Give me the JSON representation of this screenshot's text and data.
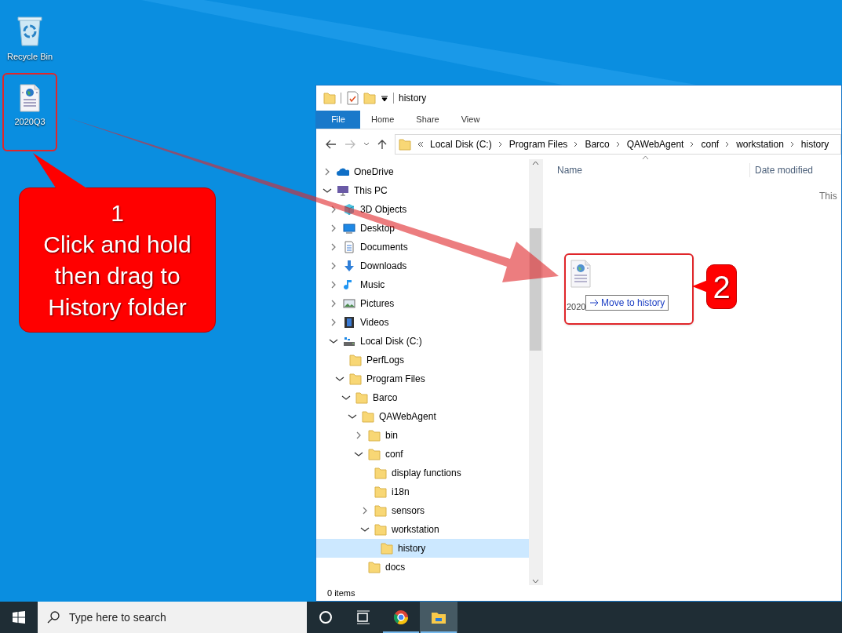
{
  "desktop": {
    "icons": [
      {
        "label": "Recycle Bin",
        "kind": "recycle-bin",
        "highlighted": false
      },
      {
        "label": "2020Q3",
        "kind": "web-file",
        "highlighted": true
      }
    ]
  },
  "explorer": {
    "title": "history",
    "ribbon_tabs": [
      {
        "label": "File",
        "kind": "file-menu"
      },
      {
        "label": "Home",
        "kind": "tab"
      },
      {
        "label": "Share",
        "kind": "tab"
      },
      {
        "label": "View",
        "kind": "tab"
      }
    ],
    "breadcrumb": [
      "Local Disk (C:)",
      "Program Files",
      "Barco",
      "QAWebAgent",
      "conf",
      "workstation",
      "history"
    ],
    "tree": [
      {
        "label": "OneDrive",
        "kind": "cloud",
        "expanded": false,
        "selected": false
      },
      {
        "label": "This PC",
        "kind": "pc",
        "expanded": true,
        "selected": false,
        "children": [
          {
            "label": "3D Objects",
            "kind": "cube",
            "expanded": false,
            "selected": false
          },
          {
            "label": "Desktop",
            "kind": "desktop",
            "expanded": false,
            "selected": false
          },
          {
            "label": "Documents",
            "kind": "document",
            "expanded": false,
            "selected": false
          },
          {
            "label": "Downloads",
            "kind": "download",
            "expanded": false,
            "selected": false
          },
          {
            "label": "Music",
            "kind": "music",
            "expanded": false,
            "selected": false
          },
          {
            "label": "Pictures",
            "kind": "picture",
            "expanded": false,
            "selected": false
          },
          {
            "label": "Videos",
            "kind": "video",
            "expanded": false,
            "selected": false
          },
          {
            "label": "Local Disk (C:)",
            "kind": "drive",
            "expanded": true,
            "selected": false,
            "children": [
              {
                "label": "PerfLogs",
                "kind": "folder",
                "selected": false
              },
              {
                "label": "Program Files",
                "kind": "folder",
                "expanded": true,
                "selected": false,
                "children": [
                  {
                    "label": "Barco",
                    "kind": "folder",
                    "expanded": true,
                    "selected": false,
                    "children": [
                      {
                        "label": "QAWebAgent",
                        "kind": "folder",
                        "expanded": true,
                        "selected": false,
                        "children": [
                          {
                            "label": "bin",
                            "kind": "folder",
                            "expanded": false,
                            "selected": false
                          },
                          {
                            "label": "conf",
                            "kind": "folder",
                            "expanded": true,
                            "selected": false,
                            "children": [
                              {
                                "label": "display functions",
                                "kind": "folder",
                                "selected": false
                              },
                              {
                                "label": "i18n",
                                "kind": "folder",
                                "selected": false
                              },
                              {
                                "label": "sensors",
                                "kind": "folder",
                                "expanded": false,
                                "selected": false
                              },
                              {
                                "label": "workstation",
                                "kind": "folder",
                                "expanded": true,
                                "selected": false,
                                "children": [
                                  {
                                    "label": "history",
                                    "kind": "folder",
                                    "selected": true
                                  }
                                ]
                              }
                            ]
                          },
                          {
                            "label": "docs",
                            "kind": "folder",
                            "selected": false
                          }
                        ]
                      }
                    ]
                  }
                ]
              }
            ]
          }
        ]
      }
    ],
    "columns": [
      "Name",
      "Date modified"
    ],
    "empty_text": "This",
    "drag": {
      "label": "2020",
      "tooltip": "Move to history"
    },
    "status": "0 items"
  },
  "callouts": [
    {
      "number": "1",
      "lines": [
        "Click and hold",
        "then drag to",
        "History folder"
      ]
    },
    {
      "number": "2"
    }
  ],
  "taskbar": {
    "search_placeholder": "Type here to search",
    "apps": [
      {
        "kind": "cortana",
        "running": false,
        "active": false
      },
      {
        "kind": "task-view",
        "running": false,
        "active": false
      },
      {
        "kind": "browser",
        "running": true,
        "active": false
      },
      {
        "kind": "file-explorer",
        "running": true,
        "active": true
      }
    ]
  }
}
